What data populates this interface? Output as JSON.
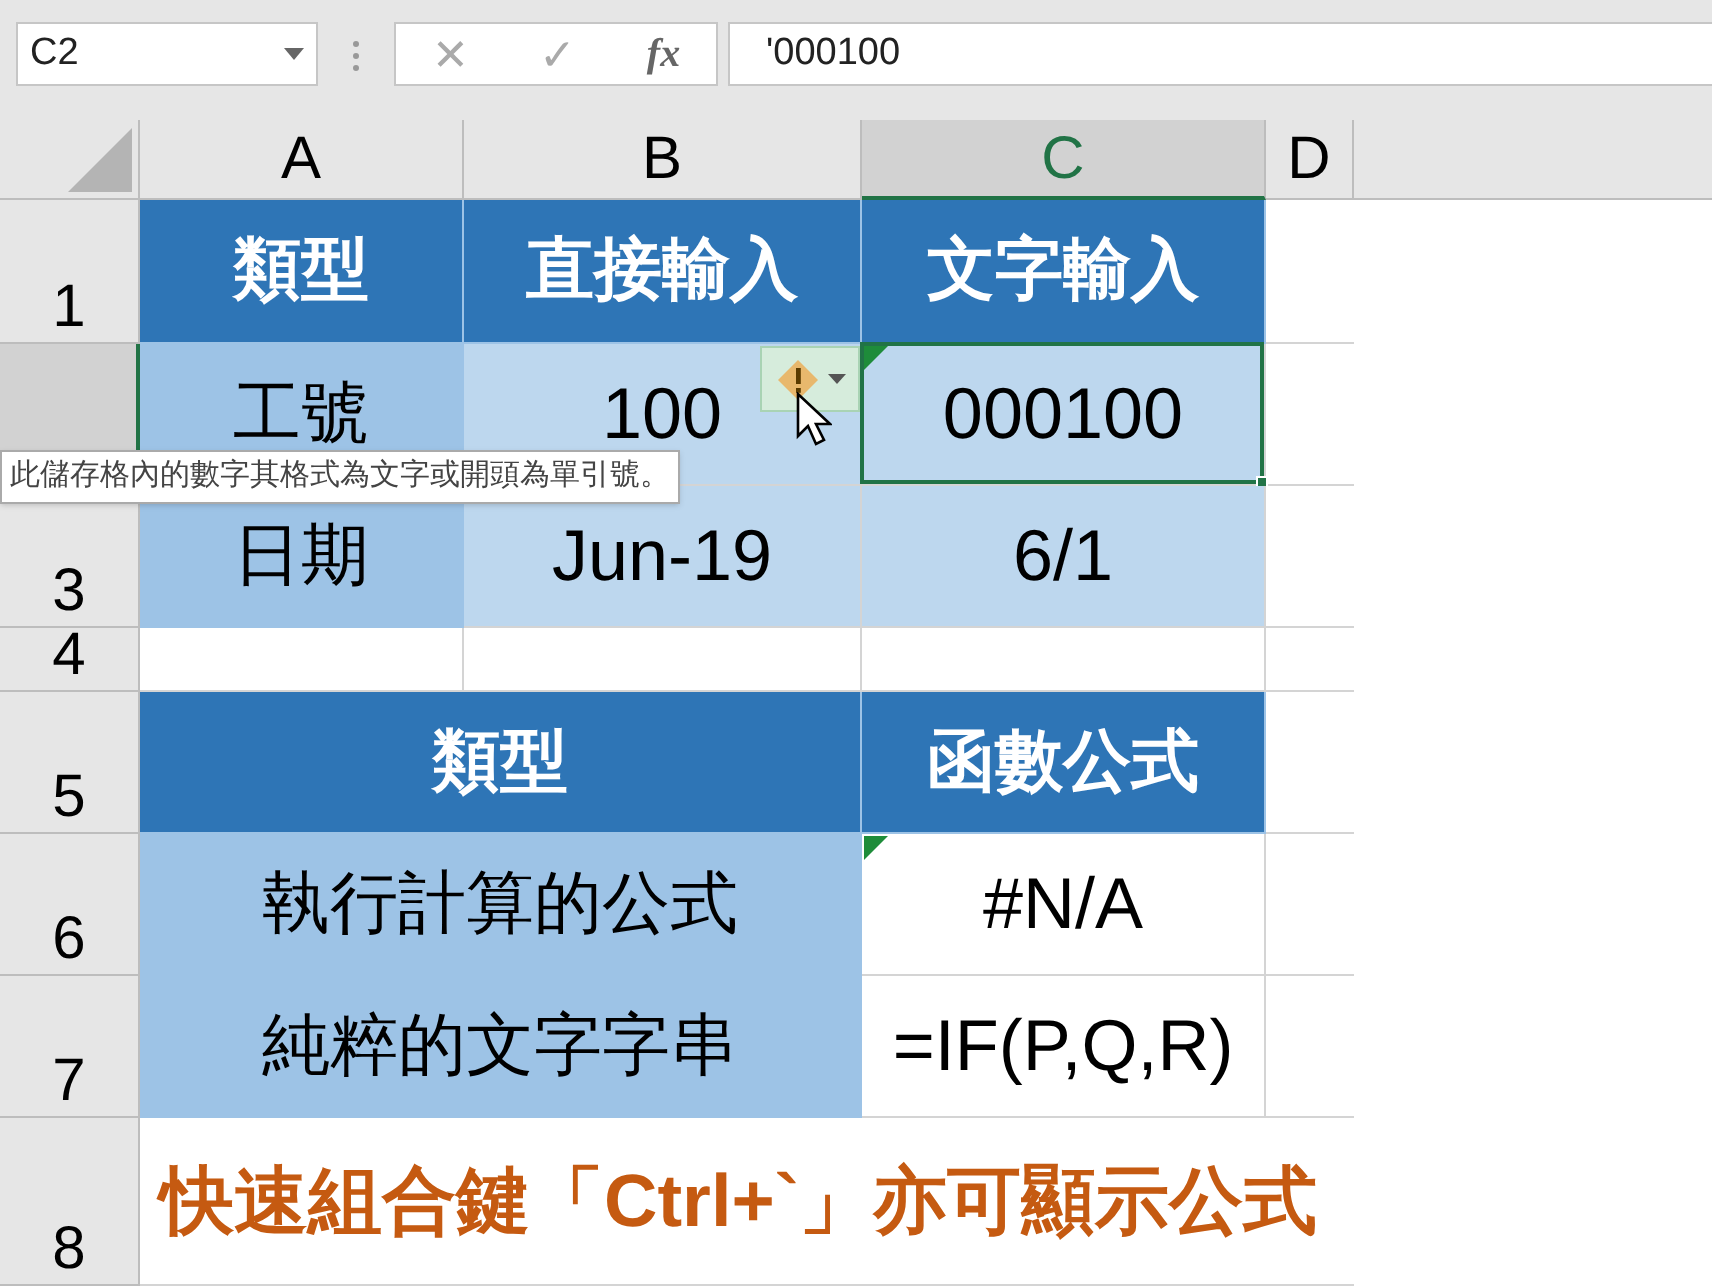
{
  "formula_bar": {
    "name_box": "C2",
    "cancel_icon_char": "✕",
    "enter_icon_char": "✓",
    "function_label": "fx",
    "formula": "'000100"
  },
  "columns": [
    {
      "label": "A",
      "selected": false
    },
    {
      "label": "B",
      "selected": false
    },
    {
      "label": "C",
      "selected": true
    },
    {
      "label": "D",
      "selected": false
    }
  ],
  "rows": [
    {
      "header": "1",
      "selected": false,
      "cells": [
        {
          "text": "類型",
          "kind": "header"
        },
        {
          "text": "直接輸入",
          "kind": "header"
        },
        {
          "text": "文字輸入",
          "kind": "header"
        }
      ]
    },
    {
      "selected": true,
      "cells": [
        {
          "text": "工號",
          "kind": "label"
        },
        {
          "text": "100",
          "kind": "value"
        },
        {
          "text": "000100",
          "kind": "value",
          "error_mark": true,
          "selected": true
        }
      ]
    },
    {
      "header": "3",
      "selected": false,
      "cells": [
        {
          "text": "日期",
          "kind": "label"
        },
        {
          "text": "Jun-19",
          "kind": "value"
        },
        {
          "text": "6/1",
          "kind": "value"
        }
      ]
    },
    {
      "header": "4",
      "selected": false
    },
    {
      "header": "5",
      "selected": false,
      "cells": [
        {
          "text": "類型",
          "kind": "header"
        },
        {
          "text": "函數公式",
          "kind": "header"
        }
      ]
    },
    {
      "header": "6",
      "selected": false,
      "cells": [
        {
          "text": "執行計算的公式",
          "kind": "label"
        },
        {
          "text": "#N/A",
          "kind": "plain",
          "error_mark": true
        }
      ]
    },
    {
      "header": "7",
      "selected": false,
      "cells": [
        {
          "text": "純粹的文字字串",
          "kind": "label"
        },
        {
          "text": "=IF(P,Q,R)",
          "kind": "plain"
        }
      ]
    },
    {
      "header": "8",
      "selected": false,
      "cells": [
        {
          "text": "快速組合鍵「Ctrl+`」亦可顯示公式",
          "kind": "note"
        }
      ]
    }
  ],
  "tooltip": "此儲存格內的數字其格式為文字或開頭為單引號。"
}
